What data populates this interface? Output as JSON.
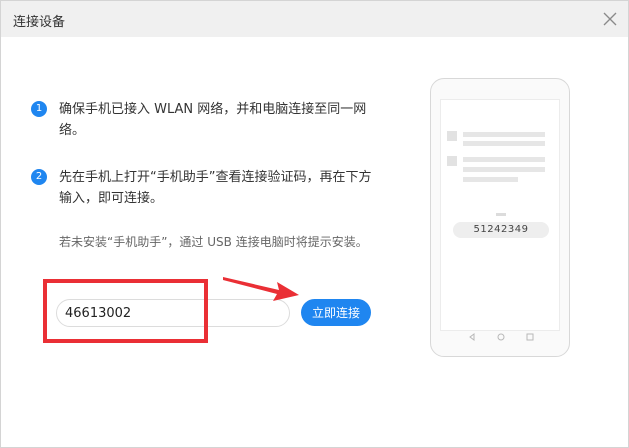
{
  "window": {
    "title": "连接设备"
  },
  "steps": [
    {
      "number": "1",
      "text": "确保手机已接入 WLAN 网络，并和电脑连接至同一网络。"
    },
    {
      "number": "2",
      "text": "先在手机上打开“手机助手”查看连接验证码，再在下方输入，即可连接。"
    }
  ],
  "hint": "若未安装“手机助手”，通过 USB 连接电脑时将提示安装。",
  "code_input": {
    "value": "46613002"
  },
  "connect_button": {
    "label": "立即连接"
  },
  "phone_illustration": {
    "code": "51242349"
  },
  "colors": {
    "accent": "#1f86f0",
    "highlight": "#ea2f35",
    "titlebar": "#f0f0f0"
  },
  "icons": {
    "close": "close-icon",
    "annotation_arrow": "arrow-icon"
  }
}
